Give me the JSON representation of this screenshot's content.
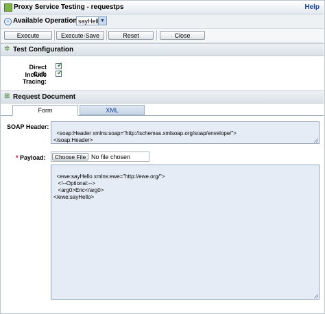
{
  "window": {
    "title": "Proxy Service Testing - requestps",
    "help_link": "Help"
  },
  "operations": {
    "label": "Available Operations:",
    "selected": "sayHello"
  },
  "toolbar": {
    "execute": "Execute",
    "execute_save": "Execute-Save",
    "reset": "Reset",
    "close": "Close"
  },
  "test_config": {
    "title": "Test Configuration",
    "direct_call_label": "Direct Call:",
    "direct_call_checked": true,
    "include_tracing_label": "Include Tracing:",
    "include_tracing_checked": true
  },
  "request_document": {
    "title": "Request Document",
    "tabs": [
      {
        "label": "Form",
        "active": true
      },
      {
        "label": "XML",
        "active": false
      }
    ],
    "soap_header_label": "SOAP Header:",
    "soap_header_value": "<soap:Header xmlns:soap=\"http://schemas.xmlsoap.org/soap/envelope/\">\n</soap:Header>",
    "payload_required": "*",
    "payload_label": "Payload:",
    "choose_file_label": "Choose File",
    "file_status": "No file chosen",
    "payload_value": "<ewe:sayHello xmlns:ewe=\"http://ewe.org/\">\n   <!--Optional:-->\n   <arg0>Eric</arg0>\n</ewe:sayHello>"
  },
  "colors": {
    "link": "#1d45a0",
    "textarea_bg": "#e5ecf6",
    "required": "#c8102e",
    "check": "#2f7a2a"
  }
}
